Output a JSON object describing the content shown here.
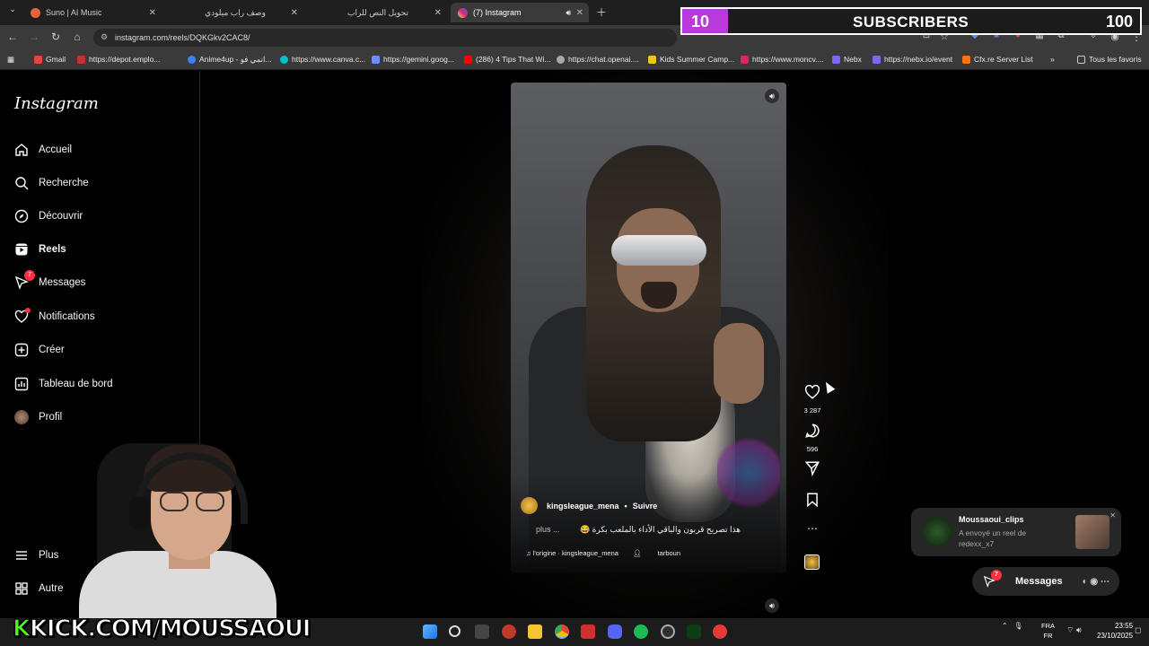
{
  "browser": {
    "tabs": [
      {
        "title": "Suno | AI Music",
        "color": "#e8623a"
      },
      {
        "title": "وصف راب ميلودي",
        "color": "#888888"
      },
      {
        "title": "تحويل النص للراب",
        "color": "#888888"
      },
      {
        "title": "(7) Instagram",
        "color": "#d6249f"
      }
    ],
    "url": "instagram.com/reels/DQKGkv2CAC8/",
    "bookmarks": [
      {
        "label": "Gmail",
        "color": "#ea4335"
      },
      {
        "label": "https://depot.emplo...",
        "color": "#c4302b"
      },
      {
        "label": "Anime4up - انمي فو...",
        "color": "#3b82f6"
      },
      {
        "label": "https://www.canva.c...",
        "color": "#00c4cc"
      },
      {
        "label": "https://gemini.goog...",
        "color": "#6c8cff"
      },
      {
        "label": "(286) 4 Tips That Wi...",
        "color": "#ff0000"
      },
      {
        "label": "https://chat.openai....",
        "color": "#aaaaaa"
      },
      {
        "label": "Kids Summer Camp...",
        "color": "#f0c419"
      },
      {
        "label": "https://www.moncv....",
        "color": "#e0245e"
      },
      {
        "label": "Nebx",
        "color": "#7b68ee"
      },
      {
        "label": "https://nebx.io/event",
        "color": "#7b68ee"
      },
      {
        "label": "Cfx.re Server List",
        "color": "#f97316"
      }
    ],
    "all_bookmarks": "Tous les favoris"
  },
  "subscriber_goal": {
    "current": "10",
    "label": "SUBSCRIBERS",
    "goal": "100",
    "progress": 0.1,
    "fill_color": "#b83bd9"
  },
  "instagram": {
    "logo": "Instagram",
    "nav": [
      {
        "label": "Accueil",
        "icon": "home-icon"
      },
      {
        "label": "Recherche",
        "icon": "search-icon"
      },
      {
        "label": "Découvrir",
        "icon": "compass-icon"
      },
      {
        "label": "Reels",
        "icon": "reels-icon"
      },
      {
        "label": "Messages",
        "icon": "messenger-icon",
        "badge": "7"
      },
      {
        "label": "Notifications",
        "icon": "heart-icon"
      },
      {
        "label": "Créer",
        "icon": "plus-square-icon"
      },
      {
        "label": "Tableau de bord",
        "icon": "dashboard-icon"
      },
      {
        "label": "Profil",
        "icon": "avatar-icon"
      }
    ],
    "more": "Plus",
    "other": "Autre",
    "reel": {
      "author": "kingsleague_mena",
      "follow": "Suivre",
      "caption": "هذا تصريح قربون والباقي الأداء بالملعب بكرة 😂",
      "caption_more": "plus ...",
      "audio": "♫ l'origine · kingsleague_mena",
      "tagged": "tarboun",
      "likes": "3 287",
      "comments": "596"
    },
    "toast": {
      "user": "Moussaoui_clips",
      "message": "A envoyé un reel de redexx_x7"
    },
    "messages_pill": {
      "label": "Messages",
      "badge": "7"
    }
  },
  "overlay": {
    "kick_prefix": "K",
    "kick_text": "KICK.COM/MOUSSAOUI"
  },
  "taskbar": {
    "lang_top": "FRA",
    "lang_bottom": "FR",
    "time": "23:55",
    "date": "23/10/2025"
  }
}
